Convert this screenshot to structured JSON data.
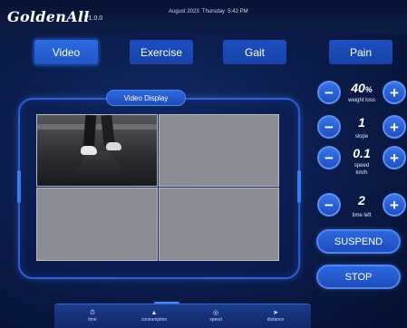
{
  "header": {
    "logo": "GoldenAll",
    "version": "V1.0.0",
    "datetime": "August 2023  Thursday  5:42 PM"
  },
  "tabs": [
    {
      "label": "Video",
      "active": true
    },
    {
      "label": "Exercise",
      "active": false
    },
    {
      "label": "Gait",
      "active": false
    },
    {
      "label": "Pain",
      "active": false
    }
  ],
  "video_display": {
    "label": "Video Display"
  },
  "controls": {
    "weight_loss": {
      "value": "40",
      "unit": "%",
      "label": "weight loss"
    },
    "slope": {
      "value": "1",
      "label": "slope"
    },
    "speed": {
      "value": "0.1",
      "label_line1": "speed",
      "label_line2": "km/h"
    },
    "time_left": {
      "value": "2",
      "label": "time left"
    },
    "minus_symbol": "−",
    "plus_symbol": "+"
  },
  "actions": {
    "suspend": "SUSPEND",
    "stop": "STOP"
  },
  "stats": [
    {
      "icon": "clock-icon",
      "label": "time"
    },
    {
      "icon": "flame-icon",
      "label": "consumption"
    },
    {
      "icon": "gauge-icon",
      "label": "speed"
    },
    {
      "icon": "arrow-icon",
      "label": "distance"
    }
  ],
  "colors": {
    "background": "#0b1d4e",
    "accent": "#2356c9",
    "button_border": "#5a90f6"
  }
}
